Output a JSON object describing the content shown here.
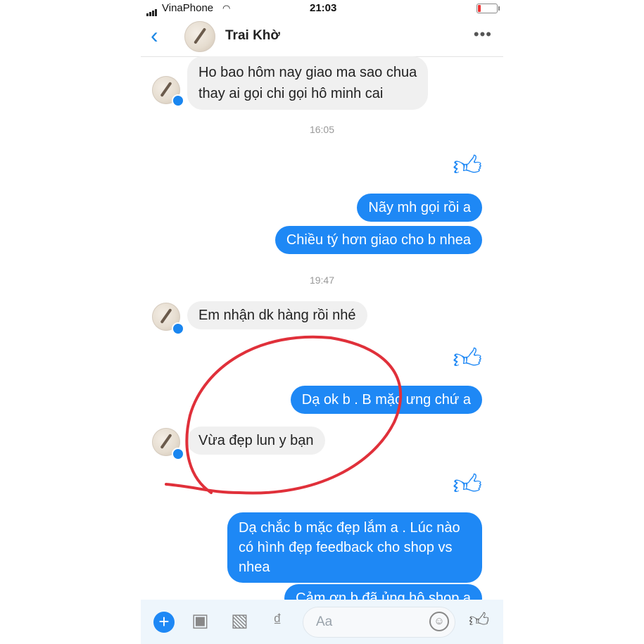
{
  "status": {
    "carrier": "VinaPhone",
    "time": "21:03"
  },
  "header": {
    "back_icon": "chevron-left-icon",
    "contact_name": "Trai Khờ",
    "more_icon": "more-dots-icon"
  },
  "messages": [
    {
      "dir": "in",
      "text": "Ho bao hôm nay giao ma sao chua\nthay ai gọi chi gọi hô minh cai"
    },
    {
      "type": "time",
      "text": "16:05"
    },
    {
      "dir": "out",
      "type": "like",
      "icon": "thumbs-up-icon"
    },
    {
      "dir": "out",
      "text": "Nãy mh gọi rồi a"
    },
    {
      "dir": "out",
      "text": "Chiều tý hơn giao cho b nhea"
    },
    {
      "type": "time",
      "text": "19:47"
    },
    {
      "dir": "in",
      "text": "Em nhận dk hàng rồi nhé"
    },
    {
      "dir": "out",
      "type": "like",
      "icon": "thumbs-up-icon"
    },
    {
      "dir": "out",
      "text": "Dạ ok b . B mặc ưng chứ a"
    },
    {
      "dir": "in",
      "text": "Vừa đẹp lun y bạn"
    },
    {
      "dir": "out",
      "type": "like",
      "icon": "thumbs-up-icon"
    },
    {
      "dir": "out",
      "text": "Dạ chắc b mặc đẹp lắm a . Lúc nào\ncó hình đẹp feedback cho shop vs\nnhea"
    },
    {
      "dir": "out",
      "text": "Cảm ơn b đã ủng hộ shop a"
    }
  ],
  "composer": {
    "placeholder": "Aa",
    "icons": [
      "plus-icon",
      "camera-icon",
      "image-icon",
      "dong-currency-icon",
      "emoji-icon",
      "thumbs-up-icon"
    ]
  },
  "colors": {
    "accent": "#1e88f5",
    "incoming_bubble": "#f0f0f0",
    "annotation": "#e0303a"
  }
}
